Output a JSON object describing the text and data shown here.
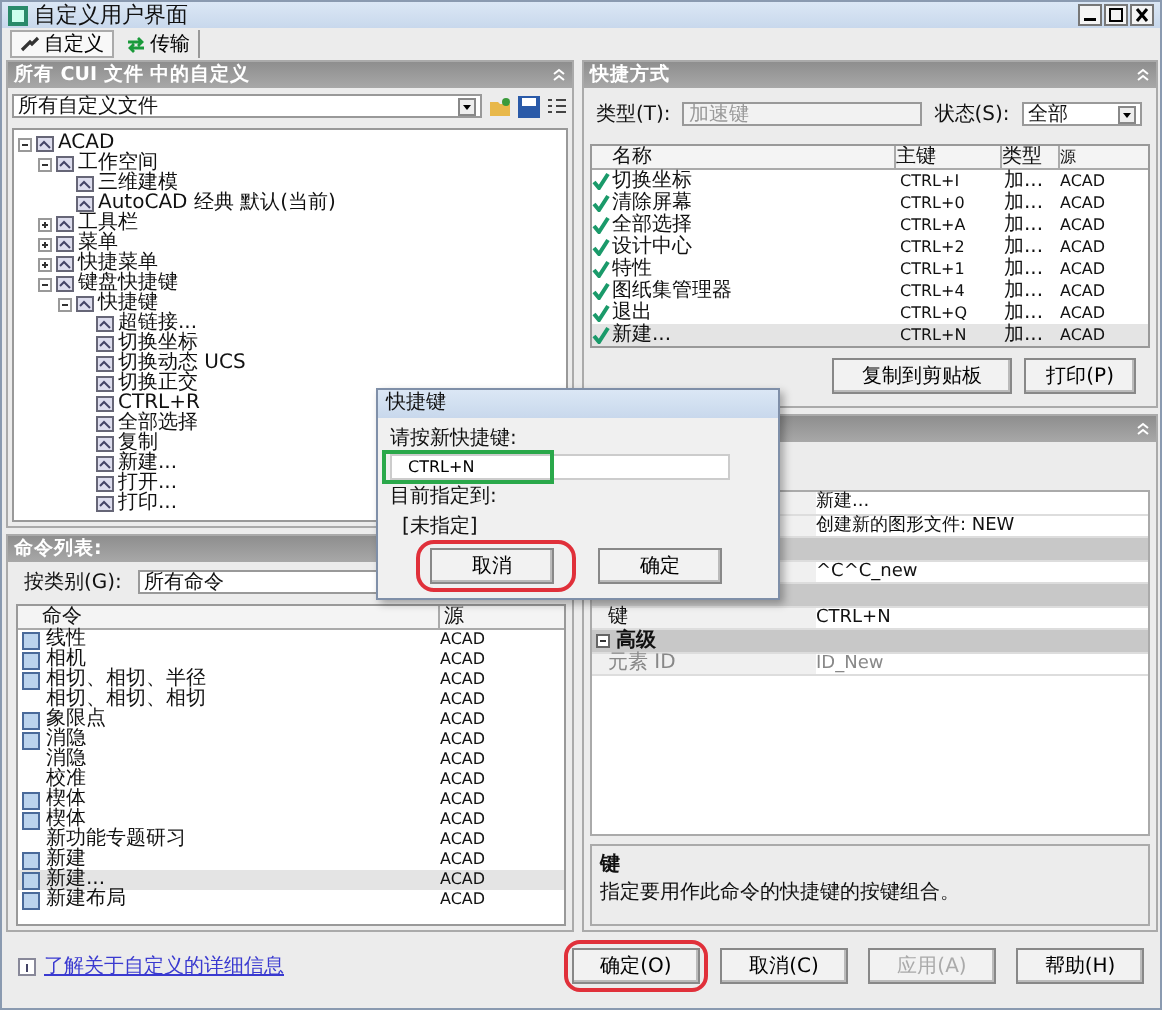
{
  "window": {
    "title": "自定义用户界面"
  },
  "tabs": [
    {
      "label": "自定义",
      "selected": true
    },
    {
      "label": "传输",
      "selected": false
    }
  ],
  "customizations": {
    "title": "所有 CUI 文件 中的自定义",
    "file_filter": "所有自定义文件",
    "tree": [
      {
        "label": "ACAD",
        "expanded": true,
        "children": [
          {
            "label": "工作空间",
            "expanded": true,
            "children": [
              {
                "label": "三维建模"
              },
              {
                "label": "AutoCAD 经典 默认(当前)"
              }
            ]
          },
          {
            "label": "工具栏",
            "expanded": false
          },
          {
            "label": "菜单",
            "expanded": false
          },
          {
            "label": "快捷菜单",
            "expanded": false
          },
          {
            "label": "键盘快捷键",
            "expanded": true,
            "children": [
              {
                "label": "快捷键",
                "expanded": true,
                "children": [
                  {
                    "label": "超链接..."
                  },
                  {
                    "label": "切换坐标"
                  },
                  {
                    "label": "切换动态 UCS"
                  },
                  {
                    "label": "切换正交"
                  },
                  {
                    "label": "CTRL+R"
                  },
                  {
                    "label": "全部选择"
                  },
                  {
                    "label": "复制"
                  },
                  {
                    "label": "新建..."
                  },
                  {
                    "label": "打开..."
                  },
                  {
                    "label": "打印..."
                  }
                ]
              }
            ]
          }
        ]
      }
    ]
  },
  "command_list": {
    "title": "命令列表:",
    "filter_label": "按类别(G):",
    "filter_value": "所有命令",
    "columns": [
      "命令",
      "源"
    ],
    "rows": [
      {
        "name": "线性",
        "source": "ACAD",
        "has_icon": true,
        "selected": false
      },
      {
        "name": "相机",
        "source": "ACAD",
        "has_icon": true,
        "selected": false
      },
      {
        "name": "相切、相切、半径",
        "source": "ACAD",
        "has_icon": true,
        "selected": false
      },
      {
        "name": "相切、相切、相切",
        "source": "ACAD",
        "has_icon": false,
        "selected": false
      },
      {
        "name": "象限点",
        "source": "ACAD",
        "has_icon": true,
        "selected": false
      },
      {
        "name": "消隐",
        "source": "ACAD",
        "has_icon": true,
        "selected": false
      },
      {
        "name": "消隐",
        "source": "ACAD",
        "has_icon": false,
        "selected": false
      },
      {
        "name": "校准",
        "source": "ACAD",
        "has_icon": false,
        "selected": false
      },
      {
        "name": "楔体",
        "source": "ACAD",
        "has_icon": true,
        "selected": false
      },
      {
        "name": "楔体",
        "source": "ACAD",
        "has_icon": true,
        "selected": false
      },
      {
        "name": "新功能专题研习",
        "source": "ACAD",
        "has_icon": false,
        "selected": false
      },
      {
        "name": "新建",
        "source": "ACAD",
        "has_icon": true,
        "selected": false
      },
      {
        "name": "新建...",
        "source": "ACAD",
        "has_icon": true,
        "selected": true
      },
      {
        "name": "新建布局",
        "source": "ACAD",
        "has_icon": true,
        "selected": false
      }
    ]
  },
  "shortcuts": {
    "title": "快捷方式",
    "type_label": "类型(T):",
    "type_value": "加速键",
    "status_label": "状态(S):",
    "status_value": "全部",
    "columns": [
      "名称",
      "主键",
      "类型",
      "源"
    ],
    "rows": [
      {
        "name": "切换坐标",
        "key": "CTRL+I",
        "type": "加...",
        "source": "ACAD",
        "selected": false
      },
      {
        "name": "清除屏幕",
        "key": "CTRL+0",
        "type": "加...",
        "source": "ACAD",
        "selected": false
      },
      {
        "name": "全部选择",
        "key": "CTRL+A",
        "type": "加...",
        "source": "ACAD",
        "selected": false
      },
      {
        "name": "设计中心",
        "key": "CTRL+2",
        "type": "加...",
        "source": "ACAD",
        "selected": false
      },
      {
        "name": "特性",
        "key": "CTRL+1",
        "type": "加...",
        "source": "ACAD",
        "selected": false
      },
      {
        "name": "图纸集管理器",
        "key": "CTRL+4",
        "type": "加...",
        "source": "ACAD",
        "selected": false
      },
      {
        "name": "退出",
        "key": "CTRL+Q",
        "type": "加...",
        "source": "ACAD",
        "selected": false
      },
      {
        "name": "新建...",
        "key": "CTRL+N",
        "type": "加...",
        "source": "ACAD",
        "selected": true
      }
    ],
    "buttons": [
      "复制到剪贴板",
      "打印(P)"
    ]
  },
  "properties": {
    "rows": [
      {
        "kind": "property",
        "value": "新建..."
      },
      {
        "kind": "property",
        "value": "创建新的图形文件:  NEW"
      },
      {
        "kind": "category"
      },
      {
        "kind": "property",
        "value": "^C^C_new"
      },
      {
        "kind": "category"
      },
      {
        "kind": "property",
        "label": "键",
        "value": "CTRL+N"
      },
      {
        "kind": "category",
        "label": "高级",
        "expanded": true
      },
      {
        "kind": "readonly",
        "label": "元素 ID",
        "value": "ID_New"
      }
    ],
    "description_title": "键",
    "description": "指定要用作此命令的快捷键的按键组合。"
  },
  "dialog": {
    "title": "快捷键",
    "prompt": "请按新快捷键:",
    "value": "CTRL+N",
    "value_highlight": {
      "color": "#2aa84a"
    },
    "assigned_label": "目前指定到:",
    "assigned_value": "[未指定]",
    "buttons": [
      {
        "label": "取消",
        "highlight": {
          "color": "#e0303a"
        }
      },
      {
        "label": "确定"
      }
    ]
  },
  "footer": {
    "link": "了解关于自定义的详细信息",
    "buttons": [
      {
        "label": "确定(O)",
        "disabled": false,
        "highlight": {
          "color": "#e0303a"
        }
      },
      {
        "label": "取消(C)",
        "disabled": false
      },
      {
        "label": "应用(A)",
        "disabled": true
      },
      {
        "label": "帮助(H)",
        "disabled": false
      }
    ]
  }
}
